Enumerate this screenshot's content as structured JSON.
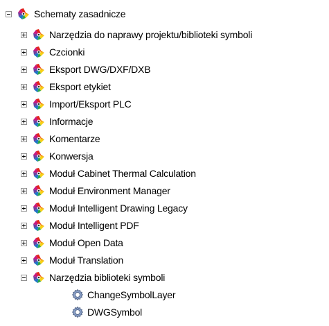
{
  "tree": {
    "root": {
      "label": "Schematy zasadnicze",
      "icon": "solidworks-electrical-icon",
      "expanded": true
    },
    "children": [
      {
        "label": "Narzędzia do naprawy projektu/biblioteki symboli",
        "icon": "solidworks-electrical-icon",
        "expanded": false
      },
      {
        "label": "Czcionki",
        "icon": "solidworks-electrical-icon",
        "expanded": false
      },
      {
        "label": "Eksport DWG/DXF/DXB",
        "icon": "solidworks-electrical-icon",
        "expanded": false
      },
      {
        "label": "Eksport etykiet",
        "icon": "solidworks-electrical-icon",
        "expanded": false
      },
      {
        "label": "Import/Eksport PLC",
        "icon": "solidworks-electrical-icon",
        "expanded": false
      },
      {
        "label": "Informacje",
        "icon": "solidworks-electrical-icon",
        "expanded": false
      },
      {
        "label": "Komentarze",
        "icon": "solidworks-electrical-icon",
        "expanded": false
      },
      {
        "label": "Konwersja",
        "icon": "solidworks-electrical-icon",
        "expanded": false
      },
      {
        "label": "Moduł Cabinet Thermal Calculation",
        "icon": "solidworks-electrical-icon",
        "expanded": false
      },
      {
        "label": "Moduł Environment Manager",
        "icon": "solidworks-electrical-icon",
        "expanded": false
      },
      {
        "label": "Moduł Intelligent Drawing Legacy",
        "icon": "solidworks-electrical-icon",
        "expanded": false
      },
      {
        "label": "Moduł Intelligent PDF",
        "icon": "solidworks-electrical-icon",
        "expanded": false
      },
      {
        "label": "Moduł Open Data",
        "icon": "solidworks-electrical-icon",
        "expanded": false
      },
      {
        "label": "Moduł Translation",
        "icon": "solidworks-electrical-icon",
        "expanded": false
      },
      {
        "label": "Narzędzia biblioteki symboli",
        "icon": "solidworks-electrical-icon",
        "expanded": true
      }
    ],
    "grandchildren": [
      {
        "label": "ChangeSymbolLayer",
        "icon": "gear-icon"
      },
      {
        "label": "DWGSymbol",
        "icon": "gear-icon"
      }
    ]
  },
  "colors": {
    "expander_border": "#919191",
    "gear_fill": "#8aa0c8",
    "gear_stroke": "#4b5e82"
  }
}
